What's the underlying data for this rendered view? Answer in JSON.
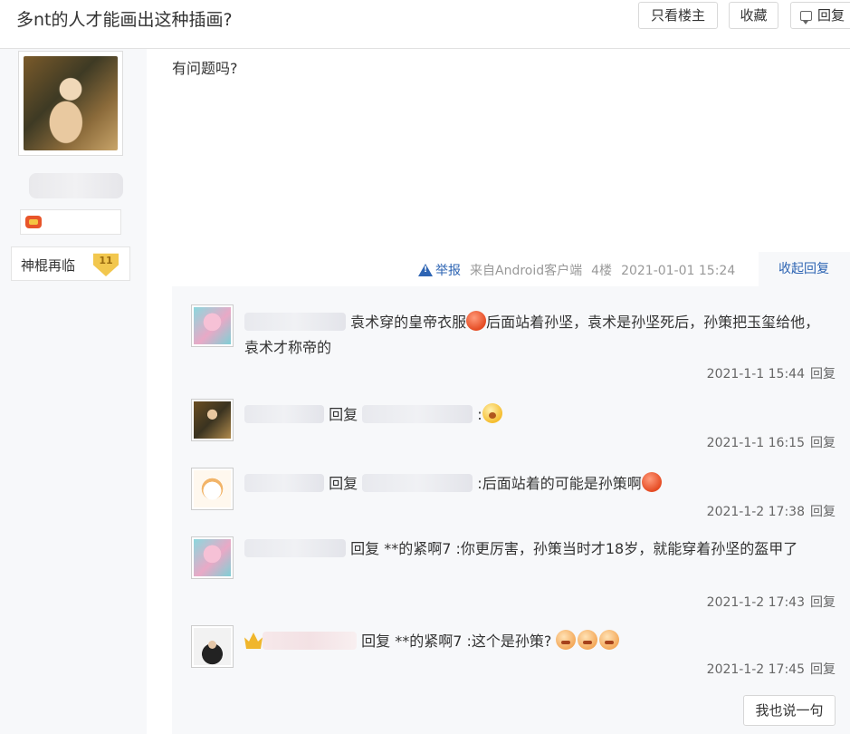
{
  "header": {
    "title": "多nt的人才能画出这种插画?",
    "only_op_label": "只看楼主",
    "favorite_label": "收藏",
    "reply_label": "回复"
  },
  "author": {
    "level_name": "神棍再临",
    "level_number": "11"
  },
  "post": {
    "content": "有问题吗?",
    "report_label": "举报",
    "source": "来自Android客户端",
    "floor": "4楼",
    "datetime": "2021-01-01 15:24",
    "collapse_label": "收起回复"
  },
  "comments": [
    {
      "avatar": "anime-pink-hair-avatar",
      "text_a": "袁术穿的皇帝衣服",
      "text_b": "后面站着孙坚，袁术是孙坚死后，孙策把玉玺给他，袁术才称帝的",
      "time": "2021-1-1 15:44",
      "reply": "回复"
    },
    {
      "avatar": "game-hero-avatar",
      "reply_word": "回复",
      "text": ":",
      "time": "2021-1-1 16:15",
      "reply": "回复"
    },
    {
      "avatar": "cartoon-cat-avatar",
      "reply_word": "回复",
      "text": ":后面站着的可能是孙策啊",
      "time": "2021-1-2 17:38",
      "reply": "回复"
    },
    {
      "avatar": "anime-pink-hair-avatar",
      "reply_word": "回复",
      "target": "**的紧啊7",
      "text": ":你更厉害，孙策当时才18岁，就能穿着孙坚的盔甲了",
      "time": "2021-1-2 17:43",
      "reply": "回复"
    },
    {
      "avatar": "dark-hoodie-avatar",
      "reply_word": "回复",
      "target": "**的紧啊7",
      "text": ":这个是孙策?",
      "time": "2021-1-2 17:45",
      "reply": "回复"
    }
  ],
  "say_button_label": "我也说一句",
  "colors": {
    "link": "#2d64b3",
    "panel_bg": "#f7f8fa",
    "meta_gray": "#999999"
  }
}
